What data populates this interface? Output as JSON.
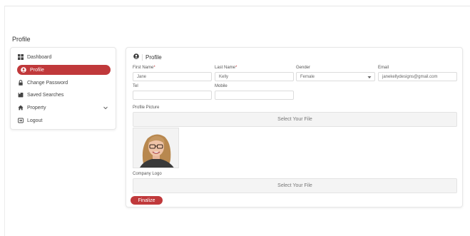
{
  "page": {
    "title": "Profile"
  },
  "sidebar": {
    "items": [
      {
        "label": "Dashboard",
        "icon": "dashboard-icon"
      },
      {
        "label": "Profile",
        "icon": "user-circle-icon",
        "active": true
      },
      {
        "label": "Change Password",
        "icon": "lock-icon"
      },
      {
        "label": "Saved Searches",
        "icon": "bookmark-icon"
      },
      {
        "label": "Property",
        "icon": "home-icon",
        "has_submenu": true
      },
      {
        "label": "Logout",
        "icon": "logout-icon"
      }
    ]
  },
  "card": {
    "title": "Profile",
    "fields": {
      "first_name": {
        "label": "First Name",
        "required": "*",
        "value": "Jane"
      },
      "last_name": {
        "label": "Last Name",
        "required": "*",
        "value": "Kelly"
      },
      "gender": {
        "label": "Gender",
        "value": "Female"
      },
      "email": {
        "label": "Email",
        "value": "janekellydesigns@gmail.com"
      },
      "tel": {
        "label": "Tel",
        "value": ""
      },
      "mobile": {
        "label": "Mobile",
        "value": ""
      }
    },
    "profile_picture": {
      "label": "Profile Picture",
      "dropzone": "Select Your File"
    },
    "company_logo": {
      "label": "Company Logo",
      "dropzone": "Select Your File"
    },
    "finalize_label": "Finalize"
  },
  "colors": {
    "accent": "#c0393b"
  }
}
